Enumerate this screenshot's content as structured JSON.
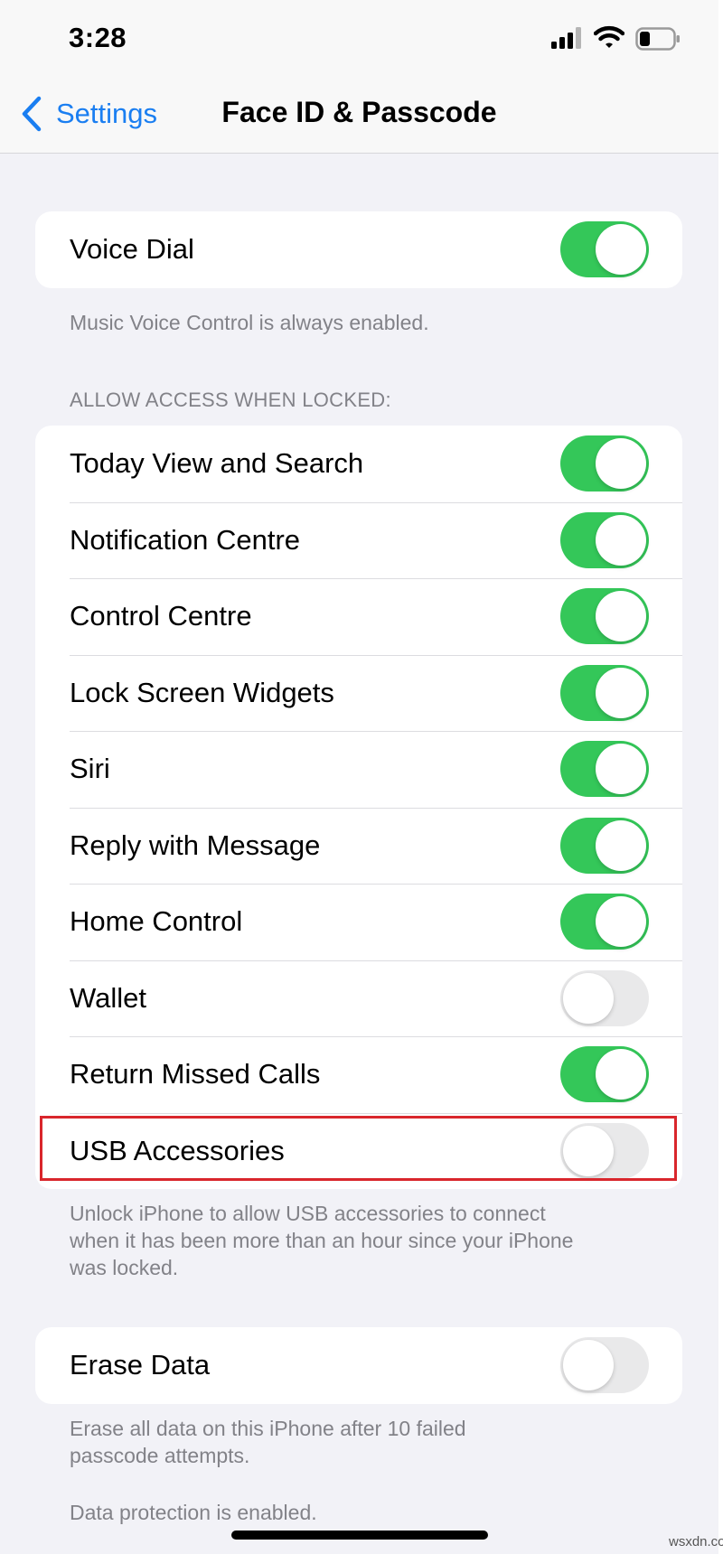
{
  "status_bar": {
    "time": "3:28"
  },
  "nav": {
    "back_label": "Settings",
    "title": "Face ID & Passcode"
  },
  "voice_group": {
    "rows": [
      {
        "label": "Voice Dial",
        "enabled": true
      }
    ],
    "footer": "Music Voice Control is always enabled."
  },
  "locked_access": {
    "header": "ALLOW ACCESS WHEN LOCKED:",
    "rows": [
      {
        "label": "Today View and Search",
        "enabled": true
      },
      {
        "label": "Notification Centre",
        "enabled": true
      },
      {
        "label": "Control Centre",
        "enabled": true
      },
      {
        "label": "Lock Screen Widgets",
        "enabled": true
      },
      {
        "label": "Siri",
        "enabled": true
      },
      {
        "label": "Reply with Message",
        "enabled": true
      },
      {
        "label": "Home Control",
        "enabled": true
      },
      {
        "label": "Wallet",
        "enabled": false
      },
      {
        "label": "Return Missed Calls",
        "enabled": true
      },
      {
        "label": "USB Accessories",
        "enabled": false
      }
    ],
    "footer_lines": [
      "Unlock iPhone to allow USB accessories to connect",
      "when it has been more than an hour since your iPhone",
      "was locked."
    ]
  },
  "erase_group": {
    "rows": [
      {
        "label": "Erase Data",
        "enabled": false
      }
    ],
    "footer_lines": [
      "Erase all data on this iPhone after 10 failed",
      "passcode attempts."
    ],
    "footer2": "Data protection is enabled."
  },
  "colors": {
    "toggle_on": "#34c759",
    "toggle_off": "#e9e9ea",
    "link": "#1a7ef1",
    "highlight": "#d9262c"
  },
  "watermark": "wsxdn.com"
}
